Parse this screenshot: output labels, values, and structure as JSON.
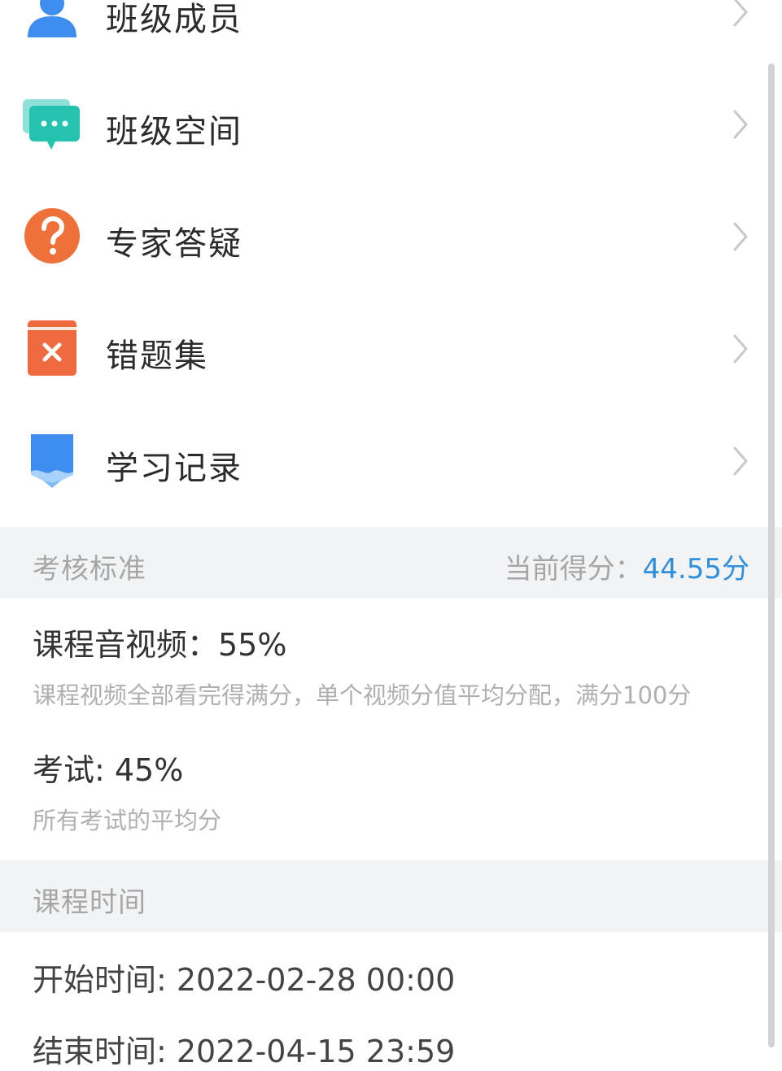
{
  "menu": {
    "items": [
      {
        "label": "班级成员",
        "icon": "member-icon"
      },
      {
        "label": "班级空间",
        "icon": "chat-bubble-icon"
      },
      {
        "label": "专家答疑",
        "icon": "question-icon"
      },
      {
        "label": "错题集",
        "icon": "wrong-questions-icon"
      },
      {
        "label": "学习记录",
        "icon": "study-record-icon"
      }
    ]
  },
  "assessment": {
    "section_title": "考核标准",
    "score_label": "当前得分：",
    "score_value": "44.55分",
    "criteria": [
      {
        "title": "课程音视频：55%",
        "description": "课程视频全部看完得满分，单个视频分值平均分配，满分100分"
      },
      {
        "title": "考试: 45%",
        "description": "所有考试的平均分"
      }
    ]
  },
  "course_time": {
    "section_title": "课程时间",
    "start": "开始时间: 2022-02-28 00:00",
    "end": "结束时间: 2022-04-15 23:59"
  },
  "colors": {
    "accent": "#2f8fdd",
    "member_icon": "#3d8ef0",
    "chat_icon": "#25c2b0",
    "question_icon": "#f0703a",
    "wrong_icon": "#f06a3f",
    "record_icon": "#3d8ef0",
    "section_bg": "#f1f3f5"
  }
}
